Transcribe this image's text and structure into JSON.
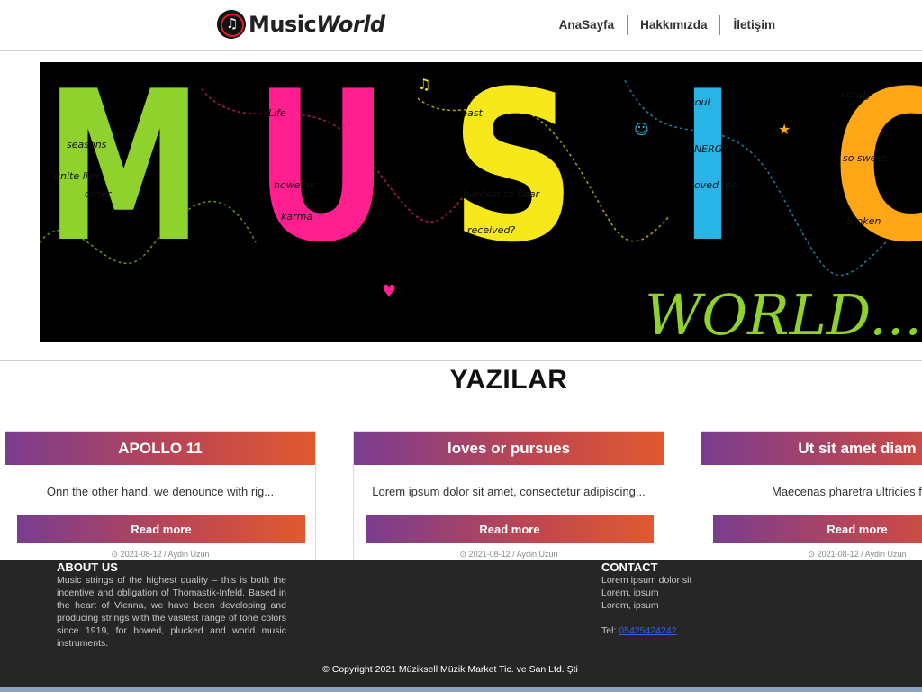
{
  "header": {
    "logo": {
      "text_main": "Music",
      "text_italic": "World",
      "icon": "vinyl-note-icon"
    },
    "nav": [
      "AnaSayfa",
      "Hakkımızda",
      "İletişim"
    ]
  },
  "banner": {
    "letters": [
      "M",
      "U",
      "S",
      "I",
      "C"
    ],
    "subtitle": "WORLD...",
    "colors": [
      "#8fd22d",
      "#ff1f8e",
      "#f7e81b",
      "#28b4e6",
      "#ffa716"
    ]
  },
  "section_title": "YAZILAR",
  "cards": [
    {
      "title": "APOLLO 11",
      "excerpt": "Onn the other hand, we denounce with rig...",
      "button": "Read more",
      "meta": "⊙ 2021-08-12 / Aydin Uzun"
    },
    {
      "title": "loves or pursues",
      "excerpt": "Lorem ipsum dolor sit amet, consectetur adipiscing...",
      "button": "Read more",
      "meta": "⊙ 2021-08-12 / Aydin Uzun"
    },
    {
      "title": "Ut sit amet diam",
      "excerpt": "Maecenas pharetra ultricies felis,",
      "button": "Read more",
      "meta": "⊙ 2021-08-12 / Aydin Uzun"
    }
  ],
  "footer": {
    "about": {
      "title": "ABOUT US",
      "text": "Music strings of the highest quality – this is both the incentive and obligation of Thomastik-Infeld. Based in the heart of Vienna, we have been developing and producing strings with the vastest range of tone colors since 1919, for bowed, plucked and world music instruments."
    },
    "contact": {
      "title": "CONTACT",
      "lines": [
        "Lorem ipsum dolor sit",
        "Lorem, ipsum",
        "Lorem, ipsum"
      ],
      "tel_label": "Tel:",
      "tel_value": "05425424242"
    },
    "copyright": "© Copyright 2021 Müziksell Müzik Market Tic. ve San Ltd. Şti"
  }
}
